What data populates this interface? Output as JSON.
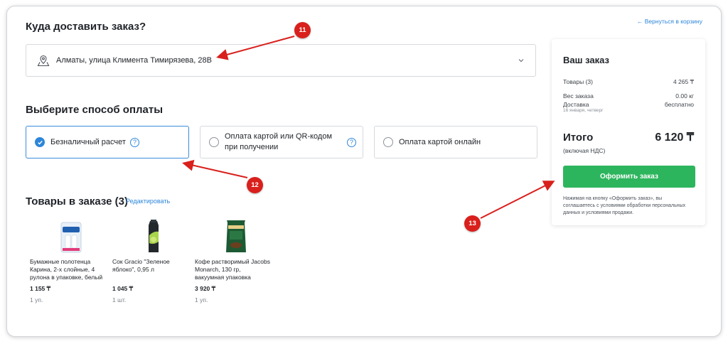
{
  "delivery": {
    "heading": "Куда доставить заказ?",
    "address": "Алматы, улица Климента Тимирязева, 28В",
    "address_icon": "map-pin-icon",
    "chevron_icon": "chevron-down-icon"
  },
  "back_link": "← Вернуться в корзину",
  "payment": {
    "heading": "Выберите способ оплаты",
    "options": [
      {
        "label": "Безналичный расчет",
        "selected": true,
        "help": "?"
      },
      {
        "label": "Оплата картой или QR-кодом при получении",
        "selected": false,
        "help": "?"
      },
      {
        "label": "Оплата картой онлайн",
        "selected": false
      }
    ]
  },
  "items": {
    "heading": "Товары в заказе (3)",
    "edit_label": "Редактировать",
    "products": [
      {
        "name": "Бумажные полотенца Карина, 2-х слойные, 4 рулона в упаковке, белый",
        "price": "1 155 ₸",
        "qty": "1 уп."
      },
      {
        "name": "Сок Gracio \"Зеленое яблоко\", 0,95 л",
        "price": "1 045 ₸",
        "qty": "1 шт."
      },
      {
        "name": "Кофе растворимый Jacobs Monarch, 130 гр, вакуумная упаковка",
        "price": "3 920 ₸",
        "qty": "1 уп."
      }
    ]
  },
  "summary": {
    "title": "Ваш заказ",
    "goods_label": "Товары (3)",
    "goods_value": "4 265 ₸",
    "weight_label": "Вес заказа",
    "weight_value": "0.00 кг",
    "delivery_label": "Доставка",
    "delivery_value": "бесплатно",
    "delivery_date": "16 января, четверг",
    "total_label": "Итого",
    "total_value": "6 120 ₸",
    "total_note": "(включая НДС)",
    "order_button": "Оформить заказ",
    "terms": "Нажимая на кнопку «Оформить заказ», вы соглашаетесь с условиями обработки персональных данных и условиями продажи."
  },
  "annotations": {
    "badges": [
      "11",
      "12",
      "13"
    ],
    "color": "#d9201c"
  }
}
